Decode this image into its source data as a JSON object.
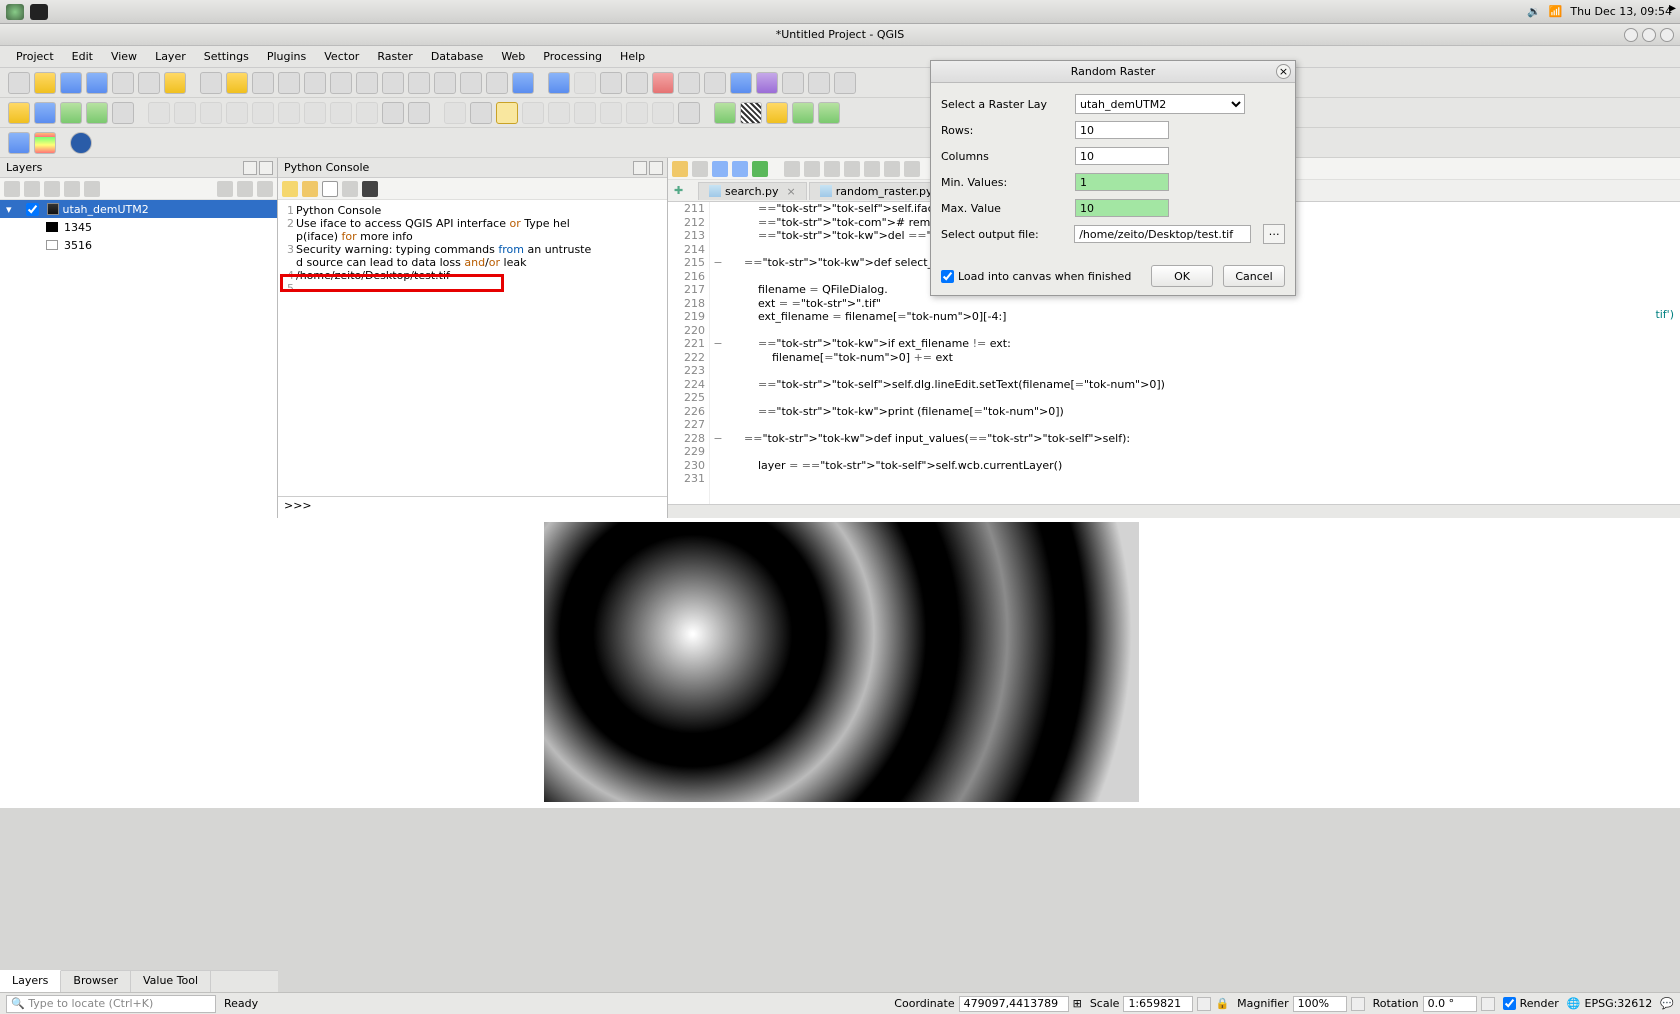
{
  "sys": {
    "clock": "Thu Dec 13, 09:54"
  },
  "window": {
    "title": "*Untitled Project - QGIS"
  },
  "menu": {
    "items": [
      "Project",
      "Edit",
      "View",
      "Layer",
      "Settings",
      "Plugins",
      "Vector",
      "Raster",
      "Database",
      "Web",
      "Processing",
      "Help"
    ]
  },
  "layers_panel": {
    "title": "Layers",
    "layer_name": "utah_demUTM2",
    "legend_min": "1345",
    "legend_max": "3516",
    "tabs": [
      "Layers",
      "Browser",
      "Value Tool"
    ]
  },
  "python_console": {
    "title": "Python Console",
    "lines": {
      "l1": "Python Console",
      "l2a": "Use iface to access QGIS API interface ",
      "l2b": "or",
      "l2c": " Type hel",
      "l2d": "p(iface) ",
      "l2e": "for",
      "l2f": " more info",
      "l3a": "Security warning: typing commands ",
      "l3b": "from",
      "l3c": " an untruste",
      "l3d": "d source can lead to data loss ",
      "l3e": "and",
      "l3f": "/",
      "l3g": "or",
      "l3h": " leak",
      "l4": "/home/zeito/Desktop/test.tif"
    },
    "prompt": ">>>"
  },
  "editor": {
    "tab1": "search.py",
    "tab2": "random_raster.py",
    "line_start": 211,
    "overflow_text": "tif')",
    "code": [
      "        self.iface.removeTo",
      "        # remove the toolbar",
      "        del self.toolbar",
      "",
      "    def select_output_file(self",
      "",
      "        filename = QFileDialog.",
      "        ext = \".tif\"",
      "        ext_filename = filename[0][-4:]",
      "",
      "        if ext_filename != ext:",
      "            filename[0] += ext",
      "",
      "        self.dlg.lineEdit.setText(filename[0])",
      "",
      "        print (filename[0])",
      "",
      "    def input_values(self):",
      "",
      "        layer = self.wcb.currentLayer()",
      ""
    ]
  },
  "dialog": {
    "title": "Random Raster",
    "labels": {
      "layer": "Select a Raster Lay",
      "rows": "Rows:",
      "columns": "Columns",
      "min": "Min. Values:",
      "max": "Max. Value",
      "output": "Select output file:",
      "load": "Load into canvas when finished",
      "ok": "OK",
      "cancel": "Cancel"
    },
    "values": {
      "layer": "utah_demUTM2",
      "rows": "10",
      "columns": "10",
      "min": "1",
      "max": "10",
      "output": "/home/zeito/Desktop/test.tif"
    }
  },
  "status": {
    "locator_placeholder": "Type to locate (Ctrl+K)",
    "ready": "Ready",
    "coord_label": "Coordinate",
    "coord_value": "479097,4413789",
    "scale_label": "Scale",
    "scale_value": "1:659821",
    "magnifier_label": "Magnifier",
    "magnifier_value": "100%",
    "rotation_label": "Rotation",
    "rotation_value": "0.0 °",
    "render_label": "Render",
    "crs": "EPSG:32612"
  }
}
